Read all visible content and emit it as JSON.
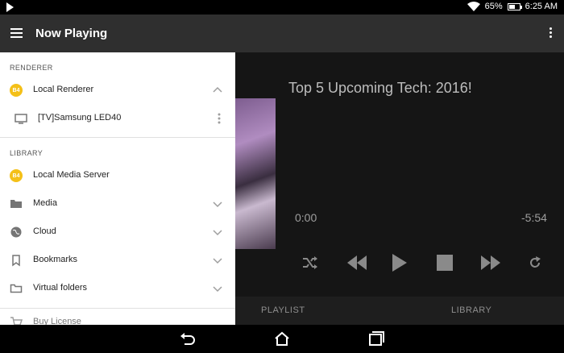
{
  "status_bar": {
    "battery": "65%",
    "battery_level": 0.65,
    "time": "6:25 AM"
  },
  "app_bar": {
    "title": "Now Playing"
  },
  "drawer": {
    "renderer_header": "RENDERER",
    "local_renderer": "Local Renderer",
    "local_renderer_badge": "B4",
    "device": "[TV]Samsung LED40",
    "library_header": "LIBRARY",
    "local_media_server": "Local Media Server",
    "local_media_server_badge": "B4",
    "items": [
      {
        "label": "Media",
        "icon": "folder-icon"
      },
      {
        "label": "Cloud",
        "icon": "globe-icon"
      },
      {
        "label": "Bookmarks",
        "icon": "bookmark-icon"
      },
      {
        "label": "Virtual folders",
        "icon": "folder-outline-icon"
      }
    ],
    "buy_license": "Buy License"
  },
  "player": {
    "track_title": "Top 5 Upcoming Tech: 2016!",
    "elapsed": "0:00",
    "remaining": "-5:54"
  },
  "tabs": {
    "playlist": "PLAYLIST",
    "library": "LIBRARY"
  },
  "colors": {
    "accent_badge": "#f4c018",
    "appbar": "#2f2f2f"
  }
}
